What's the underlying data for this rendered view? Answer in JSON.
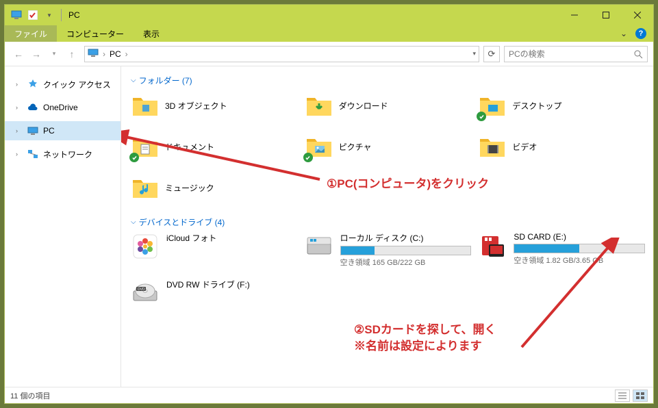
{
  "titlebar": {
    "title": "PC"
  },
  "ribbon": {
    "tabs": {
      "file": "ファイル",
      "computer": "コンピューター",
      "view": "表示"
    }
  },
  "address": {
    "location": "PC",
    "separator": "›"
  },
  "search": {
    "placeholder": "PCの検索"
  },
  "sidebar": {
    "items": [
      {
        "label": "クイック アクセス"
      },
      {
        "label": "OneDrive"
      },
      {
        "label": "PC"
      },
      {
        "label": "ネットワーク"
      }
    ]
  },
  "groups": {
    "folders": {
      "header": "フォルダー (7)"
    },
    "drives": {
      "header": "デバイスとドライブ (4)"
    }
  },
  "folders": [
    {
      "label": "3D オブジェクト"
    },
    {
      "label": "ダウンロード"
    },
    {
      "label": "デスクトップ"
    },
    {
      "label": "ドキュメント"
    },
    {
      "label": "ピクチャ"
    },
    {
      "label": "ビデオ"
    },
    {
      "label": "ミュージック"
    }
  ],
  "drives": [
    {
      "label": "iCloud フォト",
      "type": "app"
    },
    {
      "label": "ローカル ディスク (C:)",
      "free": "空き領域 165 GB/222 GB",
      "fill": 26,
      "type": "disk"
    },
    {
      "label": "SD CARD (E:)",
      "free": "空き領域 1.82 GB/3.65 GB",
      "fill": 50,
      "type": "sd"
    },
    {
      "label": "DVD RW ドライブ (F:)",
      "type": "dvd"
    }
  ],
  "status": {
    "items": "11 個の項目"
  },
  "annotations": {
    "a1": "①PC(コンピュータ)をクリック",
    "a2a": "②SDカードを探して、開く",
    "a2b": "※名前は設定によります"
  }
}
